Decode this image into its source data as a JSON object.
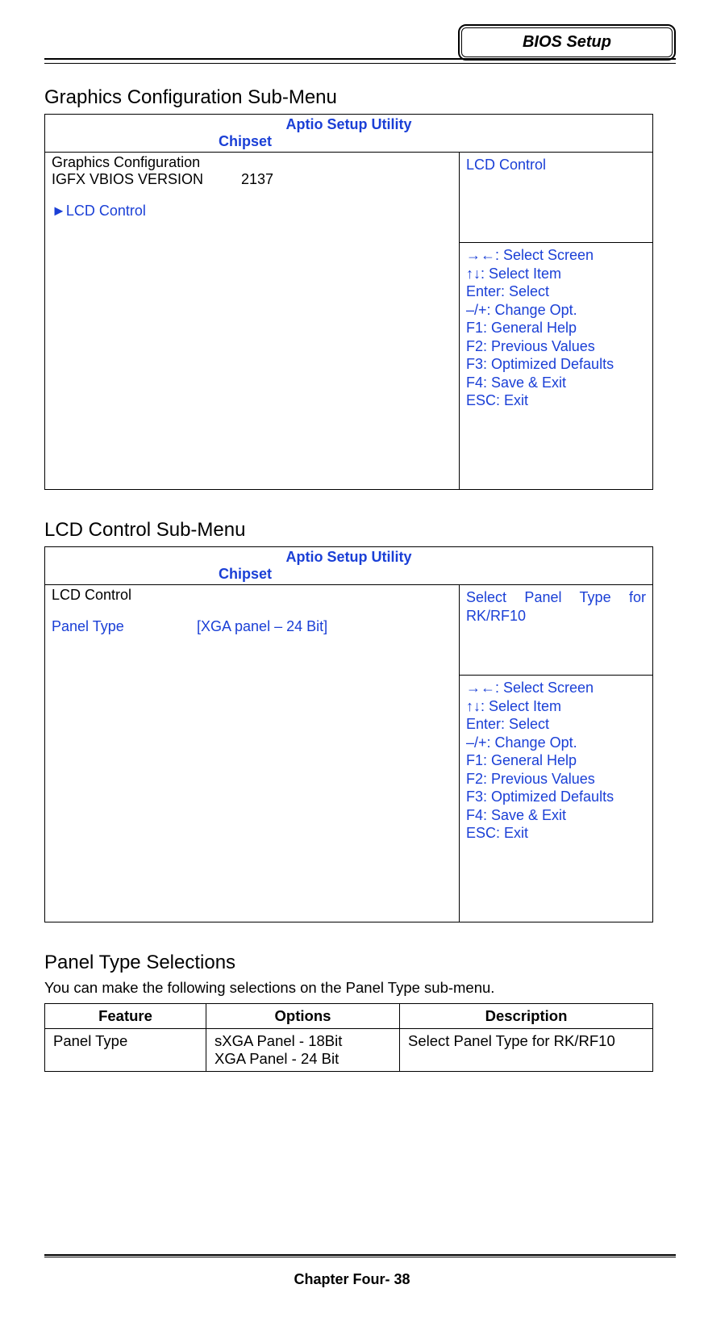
{
  "header": {
    "badge": "BIOS Setup"
  },
  "section1": {
    "title": "Graphics Configuration Sub-Menu",
    "utility_title": "Aptio Setup Utility",
    "tab": "Chipset",
    "content": {
      "heading": "Graphics Configuration",
      "version_label": "IGFX VBIOS VERSION",
      "version_value": "2137",
      "submenu": "►LCD Control"
    },
    "help": "LCD Control",
    "keys": [
      "→←: Select Screen",
      "↑↓: Select Item",
      "Enter: Select",
      "–/+: Change Opt.",
      "F1: General Help",
      "F2: Previous Values",
      "F3: Optimized Defaults",
      "F4: Save & Exit",
      "ESC: Exit"
    ]
  },
  "section2": {
    "title": "LCD Control Sub-Menu",
    "utility_title": "Aptio Setup Utility",
    "tab": "Chipset",
    "content": {
      "heading": "LCD Control",
      "item_label": "Panel Type",
      "item_value": "[XGA panel – 24 Bit]"
    },
    "help": "Select Panel Type for RK/RF10",
    "keys": [
      "→←: Select Screen",
      "↑↓: Select Item",
      "Enter: Select",
      "–/+: Change Opt.",
      "F1: General Help",
      "F2: Previous Values",
      "F3: Optimized Defaults",
      "F4: Save & Exit",
      "ESC: Exit"
    ]
  },
  "section3": {
    "title": "Panel Type Selections",
    "intro": "You can make the following selections on the Panel Type sub-menu.",
    "headers": {
      "feature": "Feature",
      "options": "Options",
      "description": "Description"
    },
    "rows": [
      {
        "feature": "Panel Type",
        "options": [
          "sXGA Panel - 18Bit",
          "XGA Panel - 24 Bit"
        ],
        "description": "Select Panel Type for RK/RF10"
      }
    ]
  },
  "footer": {
    "text": "Chapter Four- 38"
  }
}
